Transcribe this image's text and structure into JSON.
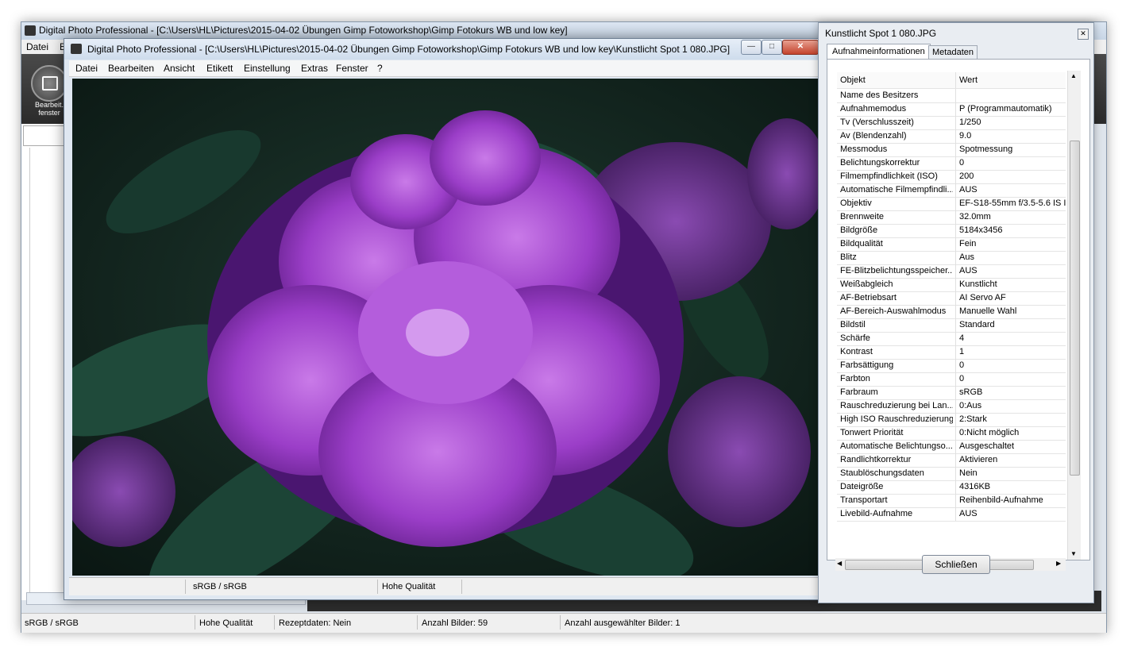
{
  "main_window": {
    "title": "Digital Photo Professional - [C:\\Users\\HL\\Pictures\\2015-04-02 Übungen  Gimp Fotoworkshop\\Gimp Fotokurs WB und low key]",
    "menu": [
      "Datei",
      "B"
    ],
    "edit_button_label": "Bearbeit. fenster",
    "status": {
      "color_space": "sRGB / sRGB",
      "quality": "Hohe Qualität",
      "recipe": "Rezeptdaten: Nein",
      "image_count": "Anzahl Bilder: 59",
      "selected_count": "Anzahl ausgewählter Bilder: 1"
    }
  },
  "image_window": {
    "title": "Digital Photo Professional - [C:\\Users\\HL\\Pictures\\2015-04-02 Übungen  Gimp Fotoworkshop\\Gimp Fotokurs WB und low key\\Kunstlicht Spot 1 080.JPG]",
    "menu": [
      "Datei",
      "Bearbeiten",
      "Ansicht",
      "Etikett",
      "Einstellung",
      "Extras",
      "Fenster",
      "?"
    ],
    "status": {
      "color_space": "sRGB / sRGB",
      "quality": "Hohe Qualität"
    },
    "image_description_icon": "purple-rhododendron-photo"
  },
  "info_window": {
    "title": "Kunstlicht Spot 1 080.JPG",
    "tabs": [
      "Aufnahmeinformationen",
      "Metadaten"
    ],
    "columns": [
      "Objekt",
      "Wert"
    ],
    "rows": [
      [
        "Name des Besitzers",
        ""
      ],
      [
        "Aufnahmemodus",
        "P (Programmautomatik)"
      ],
      [
        "Tv (Verschlusszeit)",
        "1/250"
      ],
      [
        "Av (Blendenzahl)",
        "9.0"
      ],
      [
        "Messmodus",
        "Spotmessung"
      ],
      [
        "Belichtungskorrektur",
        "0"
      ],
      [
        "Filmempfindlichkeit (ISO)",
        "200"
      ],
      [
        "Automatische Filmempfindli...",
        "AUS"
      ],
      [
        "Objektiv",
        "EF-S18-55mm f/3.5-5.6 IS I"
      ],
      [
        "Brennweite",
        "32.0mm"
      ],
      [
        "Bildgröße",
        "5184x3456"
      ],
      [
        "Bildqualität",
        "Fein"
      ],
      [
        "Blitz",
        "Aus"
      ],
      [
        "FE-Blitzbelichtungsspeicher...",
        "AUS"
      ],
      [
        "Weißabgleich",
        "Kunstlicht"
      ],
      [
        "AF-Betriebsart",
        "AI Servo AF"
      ],
      [
        "AF-Bereich-Auswahlmodus",
        "Manuelle  Wahl"
      ],
      [
        "Bildstil",
        "Standard"
      ],
      [
        "Schärfe",
        "4"
      ],
      [
        "Kontrast",
        "1"
      ],
      [
        "Farbsättigung",
        "0"
      ],
      [
        "Farbton",
        "0"
      ],
      [
        "Farbraum",
        "sRGB"
      ],
      [
        "Rauschreduzierung bei Lan...",
        "0:Aus"
      ],
      [
        "High ISO Rauschreduzierung",
        "2:Stark"
      ],
      [
        "Tonwert Priorität",
        "0:Nicht möglich"
      ],
      [
        "Automatische Belichtungso...",
        "Ausgeschaltet"
      ],
      [
        "Randlichtkorrektur",
        "Aktivieren"
      ],
      [
        "Staublöschungsdaten",
        "Nein"
      ],
      [
        "Dateigröße",
        "4316KB"
      ],
      [
        "Transportart",
        "Reihenbild-Aufnahme"
      ],
      [
        "Livebild-Aufnahme",
        "AUS"
      ]
    ],
    "close_button": "Schließen"
  }
}
